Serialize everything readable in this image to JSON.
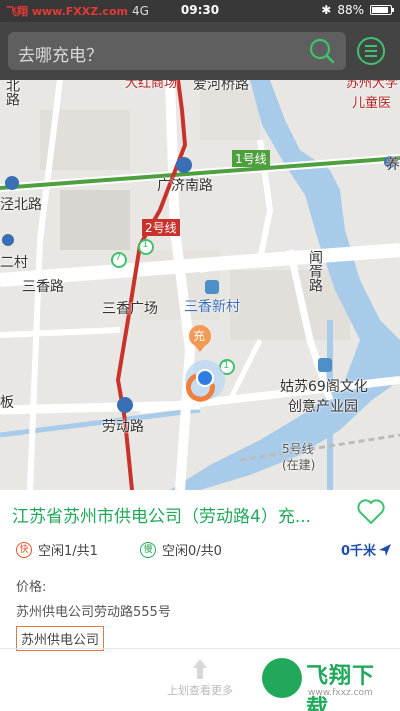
{
  "status_bar": {
    "watermark": "飞翔 www.FXXZ.com",
    "network": "4G",
    "time": "09:30",
    "battery_label": "88%",
    "battery_level": 0.88
  },
  "search": {
    "placeholder": "去哪充电？"
  },
  "map": {
    "labels": {
      "line1": "1号线",
      "line2": "2号线",
      "line5": "5号线",
      "line5_note": "(在建)",
      "guangji_south": "广济南路",
      "aihe_bridge": "爱河桥路",
      "dajin": "大红商场",
      "suzhou_child": "苏州大学",
      "child_hospital": "儿童医",
      "jing_north": "泾北路",
      "ercun": "二村",
      "sanxiang_rd": "三香路",
      "sanxiang_square": "三香广场",
      "sanxiang_village": "三香新村",
      "xuxu_rd": "闻胥路",
      "laodong_rd": "劳动路",
      "gusu69": "姑苏69阁文化",
      "creative_park": "创意产业园",
      "yang": "养",
      "bei_lu": "北路",
      "ban": "板",
      "marker_char": "充",
      "num_1a": "1",
      "num_7": "7",
      "num_1b": "1"
    }
  },
  "station": {
    "title": "江苏省苏州市供电公司（劳动路4）充...",
    "fast_badge": "快",
    "fast_status": "空闲1/共1",
    "slow_badge": "慢",
    "slow_status": "空闲0/共0",
    "distance": "0千米",
    "price_label": "价格:",
    "address": "苏州供电公司劳动路555号",
    "operator": "苏州供电公司",
    "more_hint": "上划查看更多"
  },
  "watermark_logo": {
    "name": "飞翔下载",
    "url": "www.fxxz.com"
  }
}
